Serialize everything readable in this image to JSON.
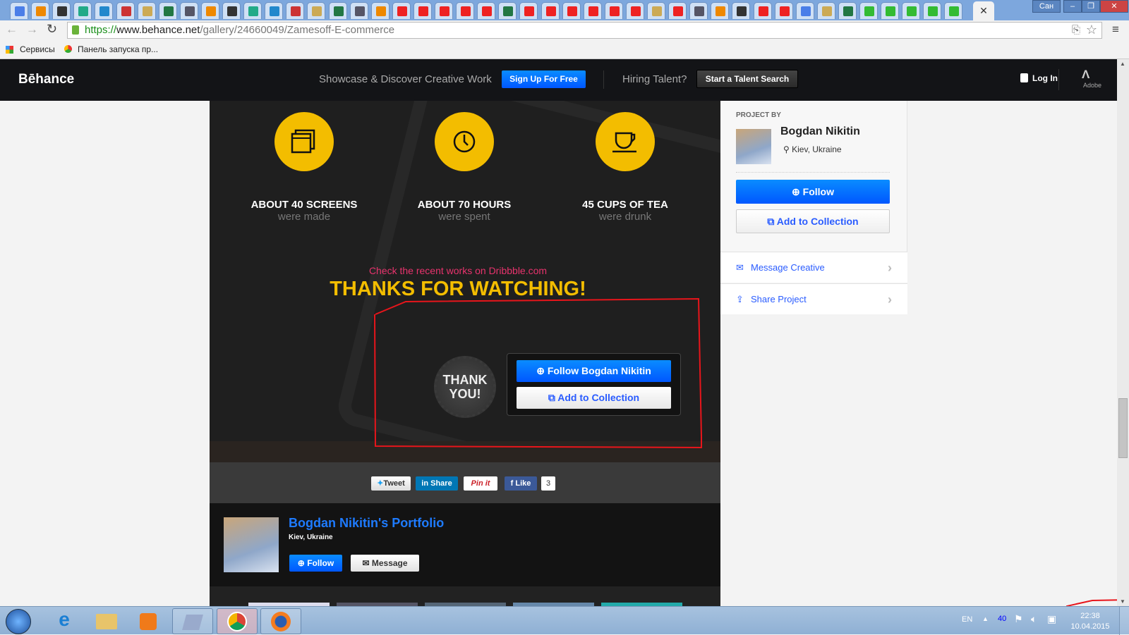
{
  "browser": {
    "tab_icons": [
      "google-icon",
      "gamepad-icon",
      "q-icon",
      "s-icon",
      "star-icon",
      "snowflake-icon",
      "paw-icon",
      "film-reel-icon",
      "phone-icon",
      "globe-icon",
      "leaf-icon",
      "z-icon",
      "t-icon",
      "mail-icon",
      "pg-icon",
      "bird-icon",
      "h-icon",
      "g-icon",
      "youtube-icon",
      "youtube-icon",
      "youtube-icon",
      "youtube-icon",
      "youtube-icon",
      "skull-icon",
      "youtube-icon",
      "youtube-icon",
      "youtube-icon",
      "youtube-icon",
      "youtube-icon",
      "youtube-icon",
      "pin-icon",
      "youtube-icon",
      "flower-icon",
      "gear-icon",
      "soviet-icon",
      "youtube-icon",
      "youtube-icon",
      "google-icon",
      "speaker-icon",
      "lock-icon",
      "s-green-icon",
      "s-green-icon",
      "s-green-icon",
      "s-green-icon",
      "s-green-icon"
    ],
    "active_tab_close": "✕",
    "window_user": "Сан",
    "url_scheme": "https://",
    "url_host": "www.behance.net",
    "url_path": "/gallery/24660049/Zamesoff-E-commerce",
    "bookmarks": [
      "Сервисы",
      "Панель запуска пр..."
    ]
  },
  "header": {
    "logo": "Bēhance",
    "tagline": "Showcase & Discover Creative Work",
    "signup": "Sign Up For Free",
    "hiring": "Hiring Talent?",
    "talent_search": "Start a Talent Search",
    "login": "Log In",
    "adobe": "Adobe"
  },
  "project": {
    "stats": [
      {
        "title": "ABOUT 40 SCREENS",
        "sub": "were made",
        "icon": "windows-icon"
      },
      {
        "title": "ABOUT 70 HOURS",
        "sub": "were spent",
        "icon": "clock-icon"
      },
      {
        "title": "45 CUPS OF TEA",
        "sub": "were drunk",
        "icon": "cup-icon"
      }
    ],
    "dribbble": "Check the recent works on Dribbble.com",
    "thanks": "THANKS FOR WATCHING!",
    "badge_line1": "THANK",
    "badge_line2": "YOU!",
    "follow_owner": "Follow Bogdan Nikitin",
    "add_collection": "Add to Collection"
  },
  "share": {
    "tweet": "Tweet",
    "linkedin": "Share",
    "pinterest": "Pin it",
    "facebook": "Like",
    "like_count": "3"
  },
  "portfolio": {
    "title": "Bogdan Nikitin's Portfolio",
    "location": "Kiev, Ukraine",
    "follow": "Follow",
    "message": "Message"
  },
  "sidebar": {
    "project_by": "PROJECT BY",
    "name": "Bogdan Nikitin",
    "location": "Kiev, Ukraine",
    "follow": "Follow",
    "add_collection": "Add to Collection",
    "message": "Message Creative",
    "share": "Share Project"
  },
  "taskbar": {
    "lang": "EN",
    "tray_counter": "40",
    "time": "22:38",
    "date": "10.04.2015"
  },
  "colors": {
    "accent": "#0057ff",
    "yellow": "#f3bd00",
    "pink": "#e8336d",
    "annotation": "#e8151b"
  }
}
